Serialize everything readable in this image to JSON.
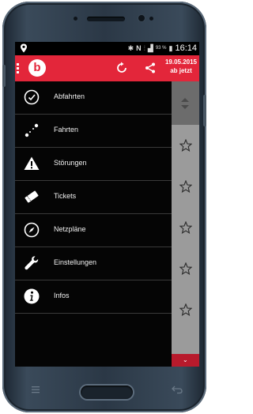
{
  "statusbar": {
    "battery": "93 %",
    "time": "16:14"
  },
  "appbar": {
    "logo_letter": "b",
    "date": "19.05.2015",
    "time_label": "ab jetzt"
  },
  "drawer": {
    "items": [
      {
        "label": "Abfahrten",
        "icon": "clock-icon"
      },
      {
        "label": "Fahrten",
        "icon": "route-icon"
      },
      {
        "label": "Störungen",
        "icon": "warning-icon"
      },
      {
        "label": "Tickets",
        "icon": "ticket-icon"
      },
      {
        "label": "Netzpläne",
        "icon": "compass-icon"
      },
      {
        "label": "Einstellungen",
        "icon": "wrench-icon"
      },
      {
        "label": "Infos",
        "icon": "info-icon"
      }
    ]
  },
  "colors": {
    "accent": "#e3263a",
    "drawer_bg": "#050505",
    "panel_bg": "#9b9b9b"
  }
}
